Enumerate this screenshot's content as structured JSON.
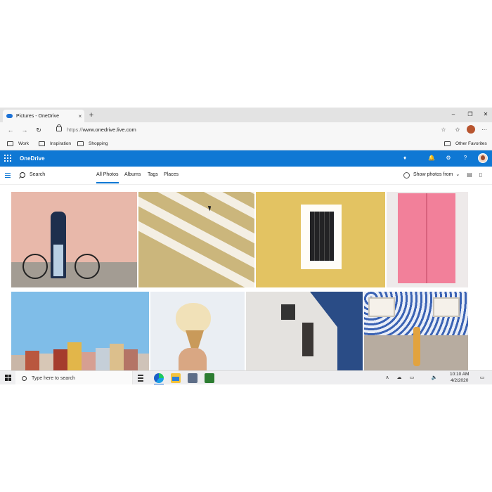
{
  "browser": {
    "tab_title": "Pictures - OneDrive",
    "tab_close": "×",
    "new_tab": "+",
    "window_controls": [
      "–",
      "❐",
      "✕"
    ],
    "nav": {
      "back": "←",
      "forward": "→",
      "refresh": "↻"
    },
    "url_prefix": "https://",
    "url_host": "www.onedrive.live.com",
    "address_icons": [
      "☆",
      "✩",
      "⋯"
    ],
    "favorites": [
      "Work",
      "Inspiration",
      "Shopping"
    ],
    "other_favorites": "Other Favorites"
  },
  "onedrive": {
    "title": "OneDrive",
    "header_icons": [
      "♦",
      "🔔",
      "⚙",
      "?"
    ],
    "search_label": "Search",
    "tabs": [
      "All Photos",
      "Albums",
      "Tags",
      "Places"
    ],
    "active_tab": "All Photos",
    "show_photos_from": "Show photos from",
    "chevron": "⌄",
    "view_icons": [
      "▤",
      "▯"
    ]
  },
  "photos": [
    {
      "name": "Man with bicycle against pink wall"
    },
    {
      "name": "Curved building balconies"
    },
    {
      "name": "Window on yellow wall"
    },
    {
      "name": "Pink door"
    },
    {
      "name": "Colorful rooftops"
    },
    {
      "name": "Ice cream cone"
    },
    {
      "name": "Street lamp on wall"
    },
    {
      "name": "Woman by tiled wall"
    }
  ],
  "taskbar": {
    "search_placeholder": "Type here to search",
    "tray": [
      "∧",
      "☁",
      "▭",
      "🔈"
    ],
    "time": "10:10 AM",
    "date": "4/2/2020",
    "notification": "▭"
  },
  "colors": {
    "accent": "#0f78d4"
  }
}
